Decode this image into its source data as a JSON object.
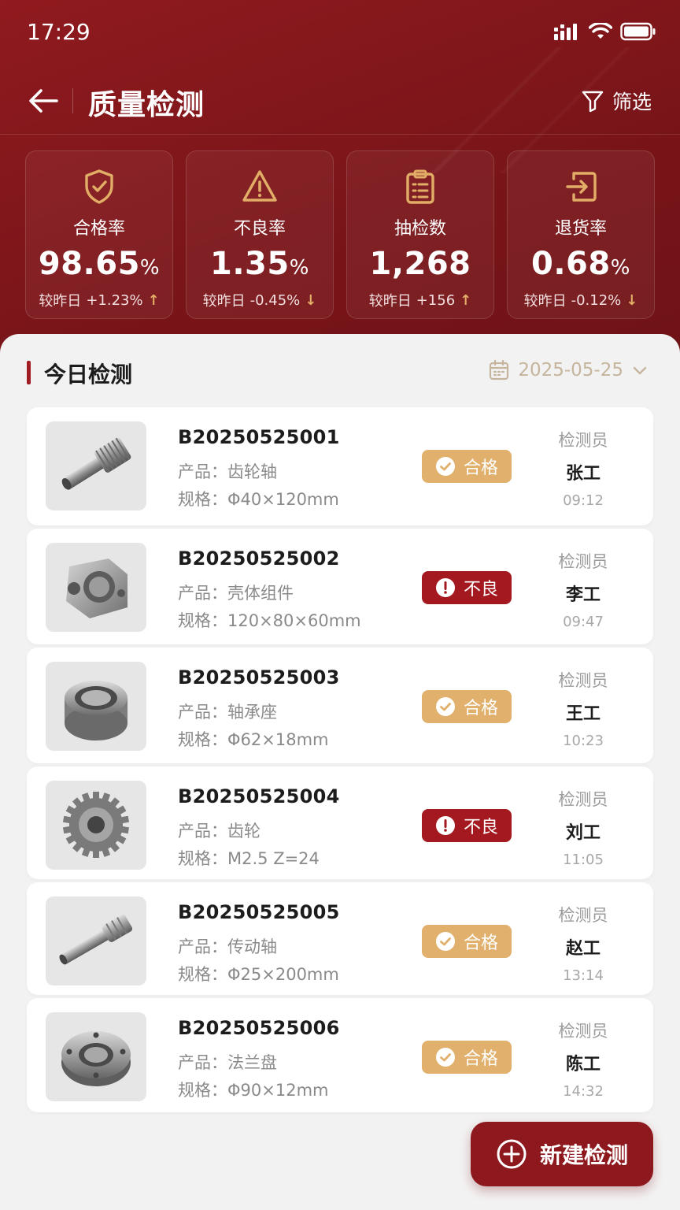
{
  "status_bar": {
    "time": "17:29"
  },
  "nav": {
    "title": "质量检测",
    "filter_label": "筛选"
  },
  "stats": [
    {
      "icon": "shield-check-icon",
      "label": "合格率",
      "value": "98.65",
      "unit": "%",
      "delta_label": "较昨日",
      "delta": "+1.23%",
      "direction": "up"
    },
    {
      "icon": "warning-triangle-icon",
      "label": "不良率",
      "value": "1.35",
      "unit": "%",
      "delta_label": "较昨日",
      "delta": "-0.45%",
      "direction": "down"
    },
    {
      "icon": "clipboard-list-icon",
      "label": "抽检数",
      "value": "1,268",
      "unit": "",
      "delta_label": "较昨日",
      "delta": "+156",
      "direction": "up"
    },
    {
      "icon": "return-icon",
      "label": "退货率",
      "value": "0.68",
      "unit": "%",
      "delta_label": "较昨日",
      "delta": "-0.12%",
      "direction": "down"
    }
  ],
  "section": {
    "title": "今日检测",
    "date": "2025-05-25"
  },
  "records": [
    {
      "batch": "B20250525001",
      "product_label": "产品：",
      "product": "齿轮轴",
      "spec_label": "规格：",
      "spec": "Φ40×120mm",
      "status": "合格",
      "status_type": "pass",
      "inspector_label": "检测员",
      "inspector": "张工",
      "time": "09:12",
      "thumb": "gear-shaft"
    },
    {
      "batch": "B20250525002",
      "product_label": "产品：",
      "product": "壳体组件",
      "spec_label": "规格：",
      "spec": "120×80×60mm",
      "status": "不良",
      "status_type": "fail",
      "inspector_label": "检测员",
      "inspector": "李工",
      "time": "09:47",
      "thumb": "housing"
    },
    {
      "batch": "B20250525003",
      "product_label": "产品：",
      "product": "轴承座",
      "spec_label": "规格：",
      "spec": "Φ62×18mm",
      "status": "合格",
      "status_type": "pass",
      "inspector_label": "检测员",
      "inspector": "王工",
      "time": "10:23",
      "thumb": "bearing"
    },
    {
      "batch": "B20250525004",
      "product_label": "产品：",
      "product": "齿轮",
      "spec_label": "规格：",
      "spec": "M2.5 Z=24",
      "status": "不良",
      "status_type": "fail",
      "inspector_label": "检测员",
      "inspector": "刘工",
      "time": "11:05",
      "thumb": "gear"
    },
    {
      "batch": "B20250525005",
      "product_label": "产品：",
      "product": "传动轴",
      "spec_label": "规格：",
      "spec": "Φ25×200mm",
      "status": "合格",
      "status_type": "pass",
      "inspector_label": "检测员",
      "inspector": "赵工",
      "time": "13:14",
      "thumb": "shaft"
    },
    {
      "batch": "B20250525006",
      "product_label": "产品：",
      "product": "法兰盘",
      "spec_label": "规格：",
      "spec": "Φ90×12mm",
      "status": "合格",
      "status_type": "pass",
      "inspector_label": "检测员",
      "inspector": "陈工",
      "time": "14:32",
      "thumb": "flange"
    }
  ],
  "fab": {
    "label": "新建检测"
  },
  "colors": {
    "brand": "#8f1a1f",
    "pass": "#e1b06c",
    "fail": "#a3191f",
    "accent_arrow": "#e2ad66"
  }
}
